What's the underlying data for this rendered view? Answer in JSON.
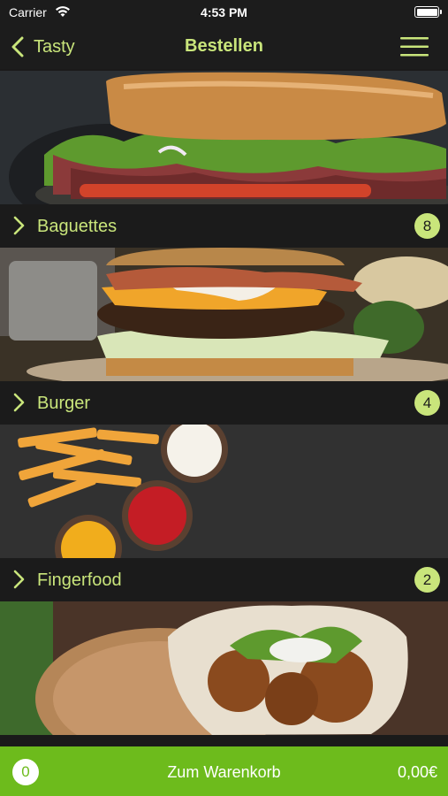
{
  "status_bar": {
    "carrier": "Carrier",
    "time": "4:53 PM",
    "icons": [
      "wifi-icon",
      "battery-icon"
    ]
  },
  "nav": {
    "back_label": "Tasty",
    "title": "Bestellen",
    "icons": [
      "chevron-left-icon",
      "hamburger-menu-icon"
    ],
    "accent_color": "#c9e57b"
  },
  "categories": [
    {
      "name": "Baguettes",
      "count": "8",
      "image": "baguette-sandwich-photo"
    },
    {
      "name": "Burger",
      "count": "4",
      "image": "burger-photo"
    },
    {
      "name": "Fingerfood",
      "count": "2",
      "image": "fries-and-dips-photo"
    },
    {
      "name": "",
      "count": "",
      "image": "falafel-pita-photo"
    }
  ],
  "cart": {
    "count": "0",
    "label": "Zum Warenkorb",
    "total": "0,00€",
    "color": "#6dbb1c"
  }
}
